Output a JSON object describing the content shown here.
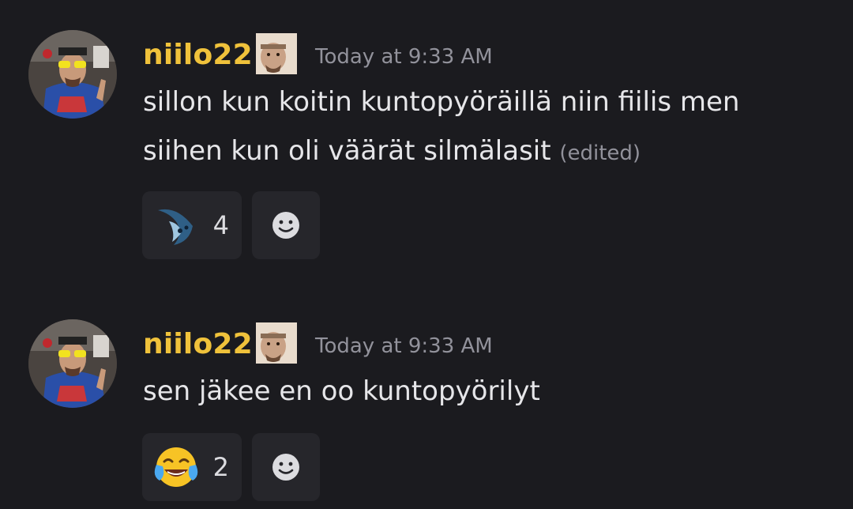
{
  "messages": [
    {
      "username": "niilo22",
      "timestamp": "Today at 9:33 AM",
      "lines": [
        "sillon kun koitin kuntopyöräillä niin fiilis men",
        "siihen kun oli väärät silmälasit"
      ],
      "edited_label": "(edited)",
      "reaction": {
        "emoji": "dark-moon-creature-emoji",
        "count": "4"
      },
      "add_reaction_icon": "smiley-face-icon"
    },
    {
      "username": "niilo22",
      "timestamp": "Today at 9:33 AM",
      "lines": [
        "sen jäkee en oo kuntopyörilyt"
      ],
      "reaction": {
        "emoji": "face-with-tears-of-joy-emoji",
        "count": "2"
      },
      "add_reaction_icon": "smiley-face-icon"
    }
  ],
  "colors": {
    "background": "#1b1b1f",
    "username": "#f0c23b",
    "timestamp": "#92929b",
    "text": "#e6e6e9",
    "reaction_bg": "#26262b"
  }
}
